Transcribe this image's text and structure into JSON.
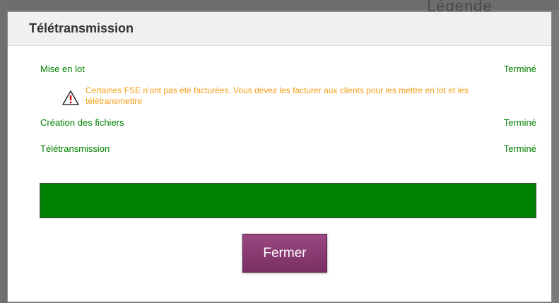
{
  "dialog": {
    "title": "Télétransmission",
    "steps": [
      {
        "label": "Mise en lot",
        "status": "Terminé"
      },
      {
        "label": "Création des fichiers",
        "status": "Terminé"
      },
      {
        "label": "Télétransmission",
        "status": "Terminé"
      }
    ],
    "warning": {
      "icon": "warning-triangle-icon",
      "text": "Certaines FSE n'ont pas été facturées. Vous devez les facturer aux clients pour les mettre en lot et les télétransmettre"
    },
    "progress": 1.0,
    "close_label": "Fermer"
  },
  "background": {
    "legend_text": "Légende"
  },
  "colors": {
    "success": "#008000",
    "warning": "#f39c12",
    "button": "#8b3a6e"
  }
}
